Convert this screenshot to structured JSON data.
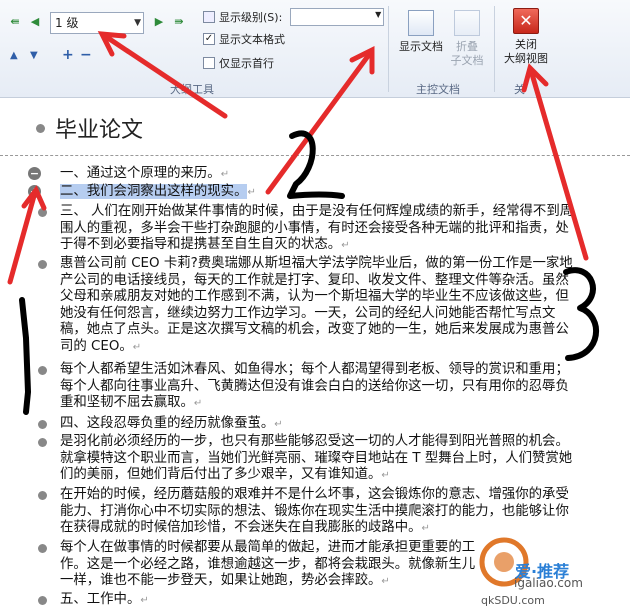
{
  "ribbon": {
    "level_value": "1 级",
    "show_level_label": "显示级别(S):",
    "show_text_format_label": "显示文本格式",
    "show_text_format_checked": "✓",
    "first_line_only_label": "仅显示首行",
    "outline_tools_label": "大纲工具",
    "show_document_label": "显示文档",
    "collapse_subdoc_label_1": "折叠",
    "collapse_subdoc_label_2": "子文档",
    "master_doc_label": "主控文档",
    "close_label_1": "关闭",
    "close_label_2": "大纲视图",
    "close_group_label": "关"
  },
  "document": {
    "title": "毕业论文",
    "paragraphs": [
      {
        "text": "一、通过这个原理的来历。"
      },
      {
        "text": "二、我们会洞察出这样的现实。"
      },
      {
        "text": "三、    人们在刚开始做某件事情的时候，由于是没有任何辉煌成绩的新手，经常得不到周围人的重视，多半会干些打杂跑腿的小事情，有时还会接受各种无端的批评和指责，处于得不到必要指导和提携甚至自生自灭的状态。"
      },
      {
        "text": "惠普公司前 CEO 卡莉?费奥瑞娜从斯坦福大学法学院毕业后，做的第一份工作是一家地产公司的电话接线员，每天的工作就是打字、复印、收发文件、整理文件等杂活。虽然父母和亲戚朋友对她的工作感到不满，认为一个斯坦福大学的毕业生不应该做这些，但她没有任何怨言，继续边努力工作边学习。一天，公司的经纪人问她能否帮忙写点文稿，她点了点头。正是这次撰写文稿的机会，改变了她的一生，她后来发展成为惠普公司的 CEO。"
      },
      {
        "text": "每个人都希望生活如沐春风、如鱼得水；每个人都渴望得到老板、领导的赏识和重用；每个人都向往事业高升、飞黄腾达但没有谁会白白的送给你这一切，只有用你的忍辱负重和坚韧不屈去赢取。"
      },
      {
        "text": "四、这段忍辱负重的经历就像蚕茧。"
      },
      {
        "text": "是羽化前必须经历的一步，也只有那些能够忍受这一切的人才能得到阳光普照的机会。就拿模特这个职业而言，当她们光鲜亮丽、璀璨夺目地站在 T 型舞台上时，人们赞赏她们的美丽，但她们背后付出了多少艰辛，又有谁知道。"
      },
      {
        "text": "在开始的时候，经历蘑菇般的艰难并不是什么坏事，这会锻炼你的意志、增强你的承受能力、打消你心中不切实际的想法、锻炼你在现实生活中摸爬滚打的能力，也能够让你在获得成就的时候倍加珍惜，不会迷失在自我膨胀的歧路中。"
      },
      {
        "text": "每个人在做事情的时候都要从最简单的做起，进而才能承担更重要的工作。这是一个必经之路，谁想逾越这一步，都将会栽跟头。就像新生儿一样，谁也不能一步登天，如果让她跑，势必会摔跤。"
      },
      {
        "text": "五、工作中。"
      }
    ]
  },
  "watermark": {
    "brand": "爱·推荐",
    "url": "igaliao.com",
    "tag": "qkSDU.com"
  },
  "annotations": {
    "label_1": "1",
    "label_2": "2",
    "label_3": "3"
  },
  "colors": {
    "highlight": "#b6cdf0",
    "arrow": "#e52b2b",
    "annotation_ink": "#000000"
  }
}
